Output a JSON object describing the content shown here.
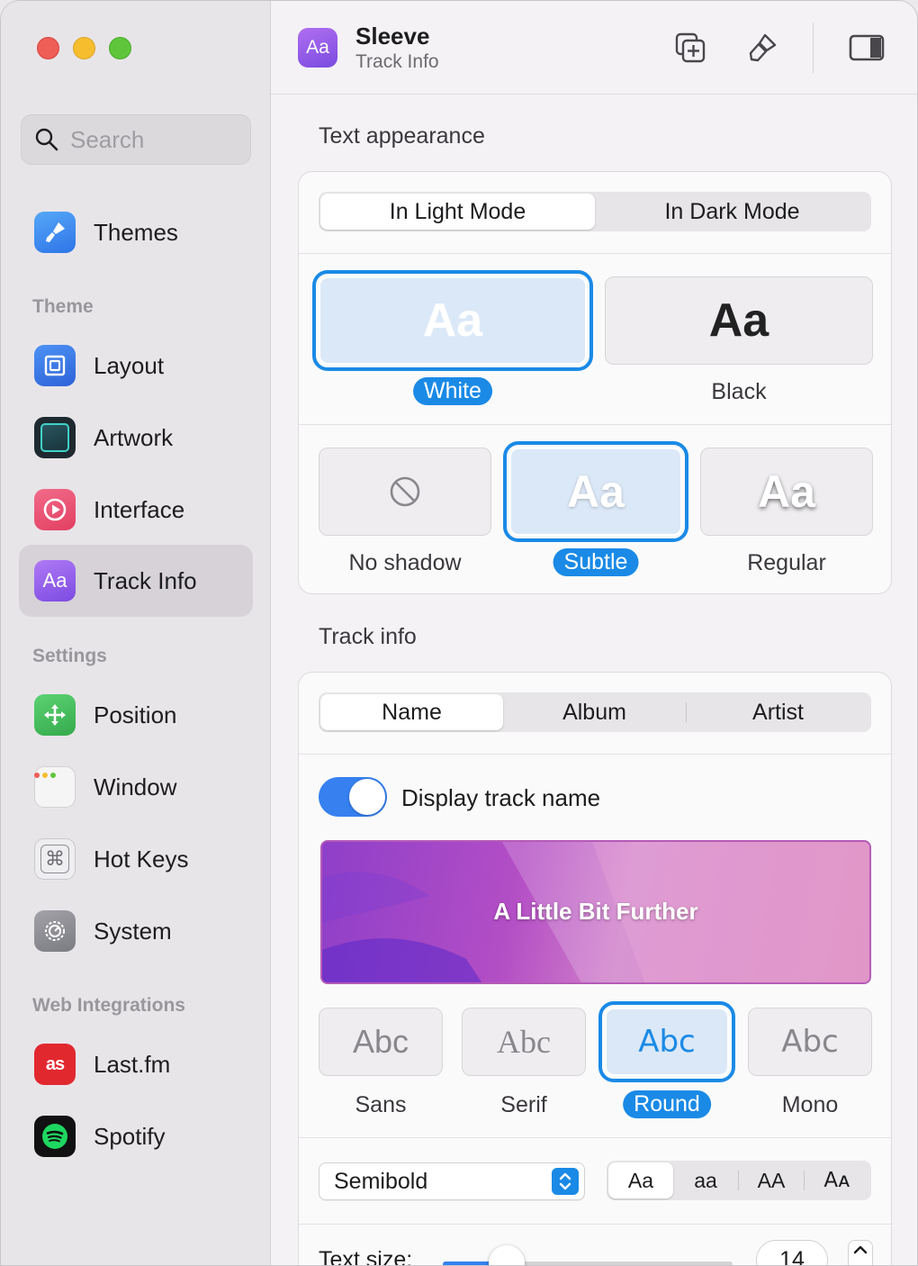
{
  "window": {
    "traffic_lights": [
      "close",
      "minimize",
      "zoom"
    ]
  },
  "sidebar": {
    "search_placeholder": "Search",
    "top_items": [
      {
        "label": "Themes",
        "icon": "paintbrush-icon",
        "color": "#3c8df0"
      }
    ],
    "sections": [
      {
        "title": "Theme",
        "items": [
          {
            "label": "Layout",
            "icon": "layout-icon",
            "color": "#3e7ef0"
          },
          {
            "label": "Artwork",
            "icon": "artwork-icon",
            "color": "#1f3b47"
          },
          {
            "label": "Interface",
            "icon": "play-circle-icon",
            "color": "#ee4f77"
          },
          {
            "label": "Track Info",
            "icon": "text-aa-icon",
            "color": "#9b5cf0",
            "selected": true
          }
        ]
      },
      {
        "title": "Settings",
        "items": [
          {
            "label": "Position",
            "icon": "move-arrows-icon",
            "color": "#4cc262"
          },
          {
            "label": "Window",
            "icon": "window-icon",
            "color": "#ededed"
          },
          {
            "label": "Hot Keys",
            "icon": "command-key-icon",
            "color": "#e6e6e9"
          },
          {
            "label": "System",
            "icon": "gear-icon",
            "color": "#8e8e93"
          }
        ]
      },
      {
        "title": "Web Integrations",
        "items": [
          {
            "label": "Last.fm",
            "icon": "lastfm-icon",
            "color": "#e2282f"
          },
          {
            "label": "Spotify",
            "icon": "spotify-icon",
            "color": "#1ed760"
          }
        ]
      }
    ]
  },
  "header": {
    "app_icon_text": "Aa",
    "title": "Sleeve",
    "subtitle": "Track Info",
    "buttons": [
      "duplicate-icon",
      "brush-icon",
      "sidebar-toggle-icon"
    ]
  },
  "text_appearance": {
    "section_title": "Text appearance",
    "mode_tabs": [
      "In Light Mode",
      "In Dark Mode"
    ],
    "mode_selected": "In Light Mode",
    "color_options": [
      {
        "sample": "Aa",
        "label": "White",
        "selected": true
      },
      {
        "sample": "Aa",
        "label": "Black",
        "selected": false
      }
    ],
    "shadow_options": [
      {
        "sample": "",
        "icon": "no-symbol-icon",
        "label": "No shadow",
        "selected": false
      },
      {
        "sample": "Aa",
        "label": "Subtle",
        "selected": true
      },
      {
        "sample": "Aa",
        "label": "Regular",
        "selected": false
      }
    ]
  },
  "track_info": {
    "section_title": "Track info",
    "tabs": [
      "Name",
      "Album",
      "Artist"
    ],
    "tab_selected": "Name",
    "toggle_label": "Display track name",
    "toggle_on": true,
    "preview_text": "A Little Bit Further",
    "font_options": [
      {
        "sample": "Abc",
        "label": "Sans",
        "selected": false
      },
      {
        "sample": "Abc",
        "label": "Serif",
        "selected": false
      },
      {
        "sample": "Abc",
        "label": "Round",
        "selected": true
      },
      {
        "sample": "Abc",
        "label": "Mono",
        "selected": false
      }
    ],
    "weight_value": "Semibold",
    "case_options": [
      "Aa",
      "aa",
      "AA",
      "Aᴀ"
    ],
    "case_selected": "Aa",
    "size_label": "Text size:",
    "size_value": "14",
    "size_fraction": 0.22
  }
}
